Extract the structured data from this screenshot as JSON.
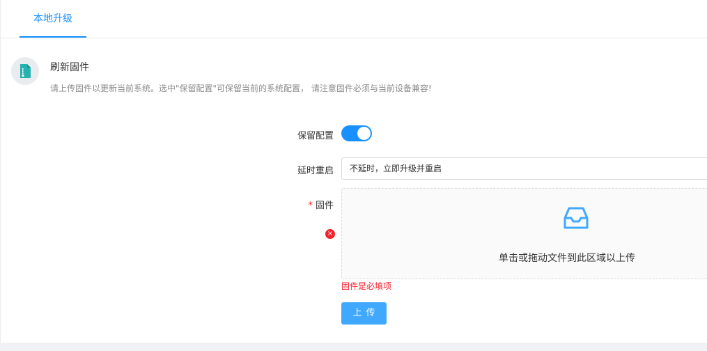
{
  "tabs": [
    {
      "label": "本地升级",
      "active": true
    }
  ],
  "intro": {
    "icon": "firmware-file-icon",
    "title": "刷新固件",
    "description": "请上传固件以更新当前系统。选中\"保留配置\"可保留当前的系统配置， 请注意固件必须与当前设备兼容!"
  },
  "form": {
    "keep_config": {
      "label": "保留配置",
      "checked": true
    },
    "delay_reboot": {
      "label": "延时重启",
      "value": "不延时，立即升级并重启"
    },
    "firmware": {
      "label": "固件",
      "required_mark": "*",
      "upload_hint": "单击或拖动文件到此区域以上传",
      "error_icon": "×",
      "error": "固件是必填项"
    },
    "submit_label": "上传"
  },
  "colors": {
    "primary": "#1890ff",
    "button": "#40a9ff",
    "error": "#f5222d"
  }
}
